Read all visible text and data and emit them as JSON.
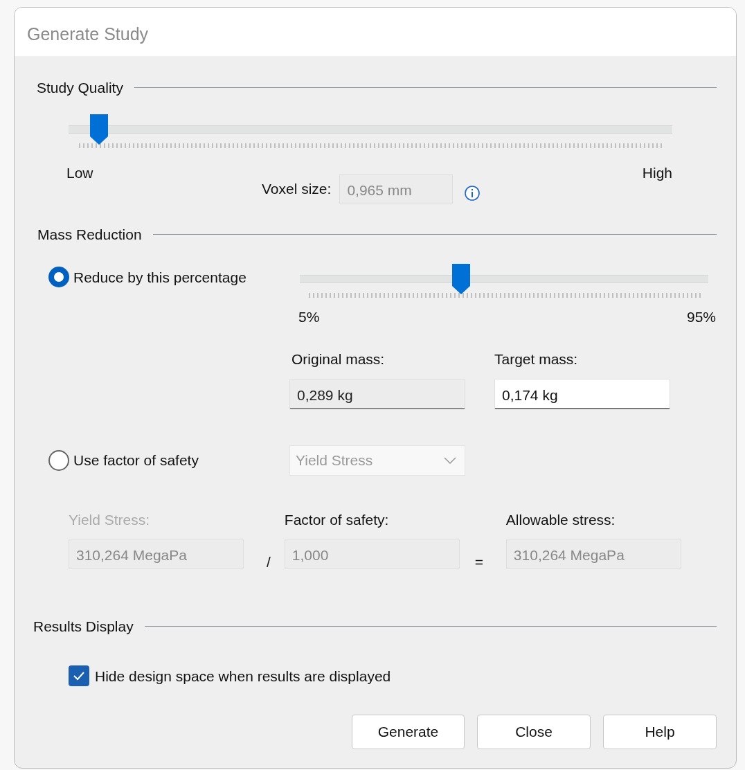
{
  "window": {
    "title": "Generate Study"
  },
  "study_quality": {
    "heading": "Study Quality",
    "slider": {
      "level": 0.05
    },
    "min_label": "Low",
    "max_label": "High",
    "voxel_label": "Voxel size:",
    "voxel_value": "0,965 mm"
  },
  "mass_reduction": {
    "heading": "Mass Reduction",
    "options": [
      {
        "label": "Reduce by this percentage",
        "selected": true
      },
      {
        "label": "Use factor of safety",
        "selected": false
      }
    ],
    "slider": {
      "level": 0.395
    },
    "min_label": "5%",
    "max_label": "95%",
    "original_mass_label": "Original mass:",
    "original_mass": "0,289 kg",
    "target_mass_label": "Target mass:",
    "target_mass": "0,174 kg",
    "stress_dropdown": {
      "value": "Yield Stress",
      "disabled": true
    },
    "yield_label": "Yield Stress:",
    "yield_value": "310,264 MegaPa",
    "divide_sign": "/",
    "factor_label": "Factor of safety:",
    "factor_value": "1,000",
    "equals_sign": "=",
    "allowable_label": "Allowable stress:",
    "allowable_value": "310,264 MegaPa"
  },
  "results_display": {
    "heading": "Results Display",
    "checkbox": {
      "label": "Hide design space when results are displayed",
      "checked": true
    }
  },
  "buttons": [
    "Generate",
    "Close",
    "Help"
  ]
}
